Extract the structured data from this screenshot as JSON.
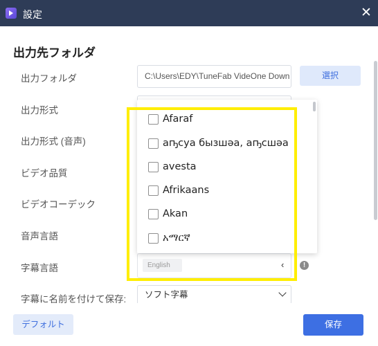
{
  "window": {
    "title": "設定",
    "close_icon": "close-icon"
  },
  "section": {
    "title": "出力先フォルダ"
  },
  "labels": {
    "output_folder": "出力フォルダ",
    "output_format": "出力形式",
    "output_format_audio": "出力形式 (音声)",
    "video_quality": "ビデオ品質",
    "video_codec": "ビデオコーデック",
    "audio_language": "音声言語",
    "subtitle_language": "字幕言語",
    "save_with_name": "字幕に名前を付けて保存:"
  },
  "output_folder": {
    "value": "C:\\Users\\EDY\\TuneFab VideOne Down",
    "select_label": "選択"
  },
  "language_dropdown": {
    "options": [
      {
        "label": "Afaraf",
        "checked": false
      },
      {
        "label": "аҧсуа бызшәа, аҧсшәа",
        "checked": false
      },
      {
        "label": "avesta",
        "checked": false
      },
      {
        "label": "Afrikaans",
        "checked": false
      },
      {
        "label": "Akan",
        "checked": false
      },
      {
        "label": "አማርኛ",
        "checked": false
      }
    ]
  },
  "subtitle_language": {
    "chip": "English",
    "chevron": "‹"
  },
  "save_with_name": {
    "value": "ソフト字幕"
  },
  "footer": {
    "default_label": "デフォルト",
    "save_label": "保存"
  },
  "colors": {
    "titlebar": "#2e3c57",
    "accent": "#3d6fe3",
    "highlight": "#ffee00"
  }
}
